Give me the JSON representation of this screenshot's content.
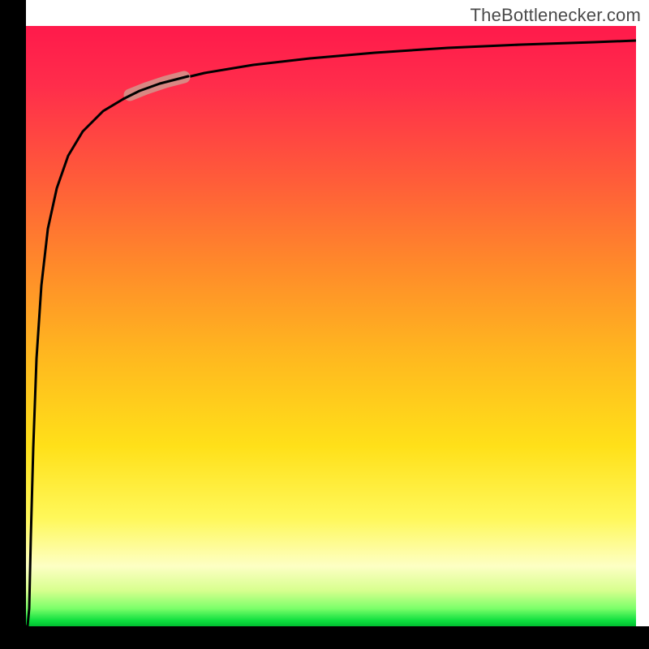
{
  "watermark": {
    "text": "TheBottlenecker.com"
  },
  "colors": {
    "axis": "#000000",
    "curve": "#000000",
    "highlight": "#d68f88",
    "gradient_stops": [
      "#ff1a4b",
      "#ff2d4b",
      "#ff5a3a",
      "#ff8a2a",
      "#ffb81f",
      "#ffe019",
      "#fff85a",
      "#fdffc4",
      "#d8ff8f",
      "#7dff6a",
      "#10e040",
      "#00c030"
    ]
  },
  "chart_data": {
    "type": "line",
    "title": "",
    "xlabel": "",
    "ylabel": "",
    "xlim": [
      0,
      100
    ],
    "ylim": [
      0,
      100
    ],
    "grid": false,
    "legend": false,
    "annotations": [
      "TheBottlenecker.com"
    ],
    "x": [
      0,
      0.7,
      1.5,
      2.5,
      4,
      6,
      9,
      13,
      18,
      21.5,
      25,
      30,
      40,
      55,
      70,
      85,
      100
    ],
    "values": [
      0,
      3,
      20,
      45,
      63,
      74,
      81.5,
      86,
      89,
      90.3,
      91.5,
      92.7,
      94.2,
      95.6,
      96.5,
      97.1,
      97.5
    ],
    "highlight_range_x": [
      18,
      25
    ],
    "note": "Bottleneck curve: starts at 0, rises steeply then asymptotically approaches ~97.5. Highlighted segment around x≈18–25, y≈89–91.5."
  }
}
